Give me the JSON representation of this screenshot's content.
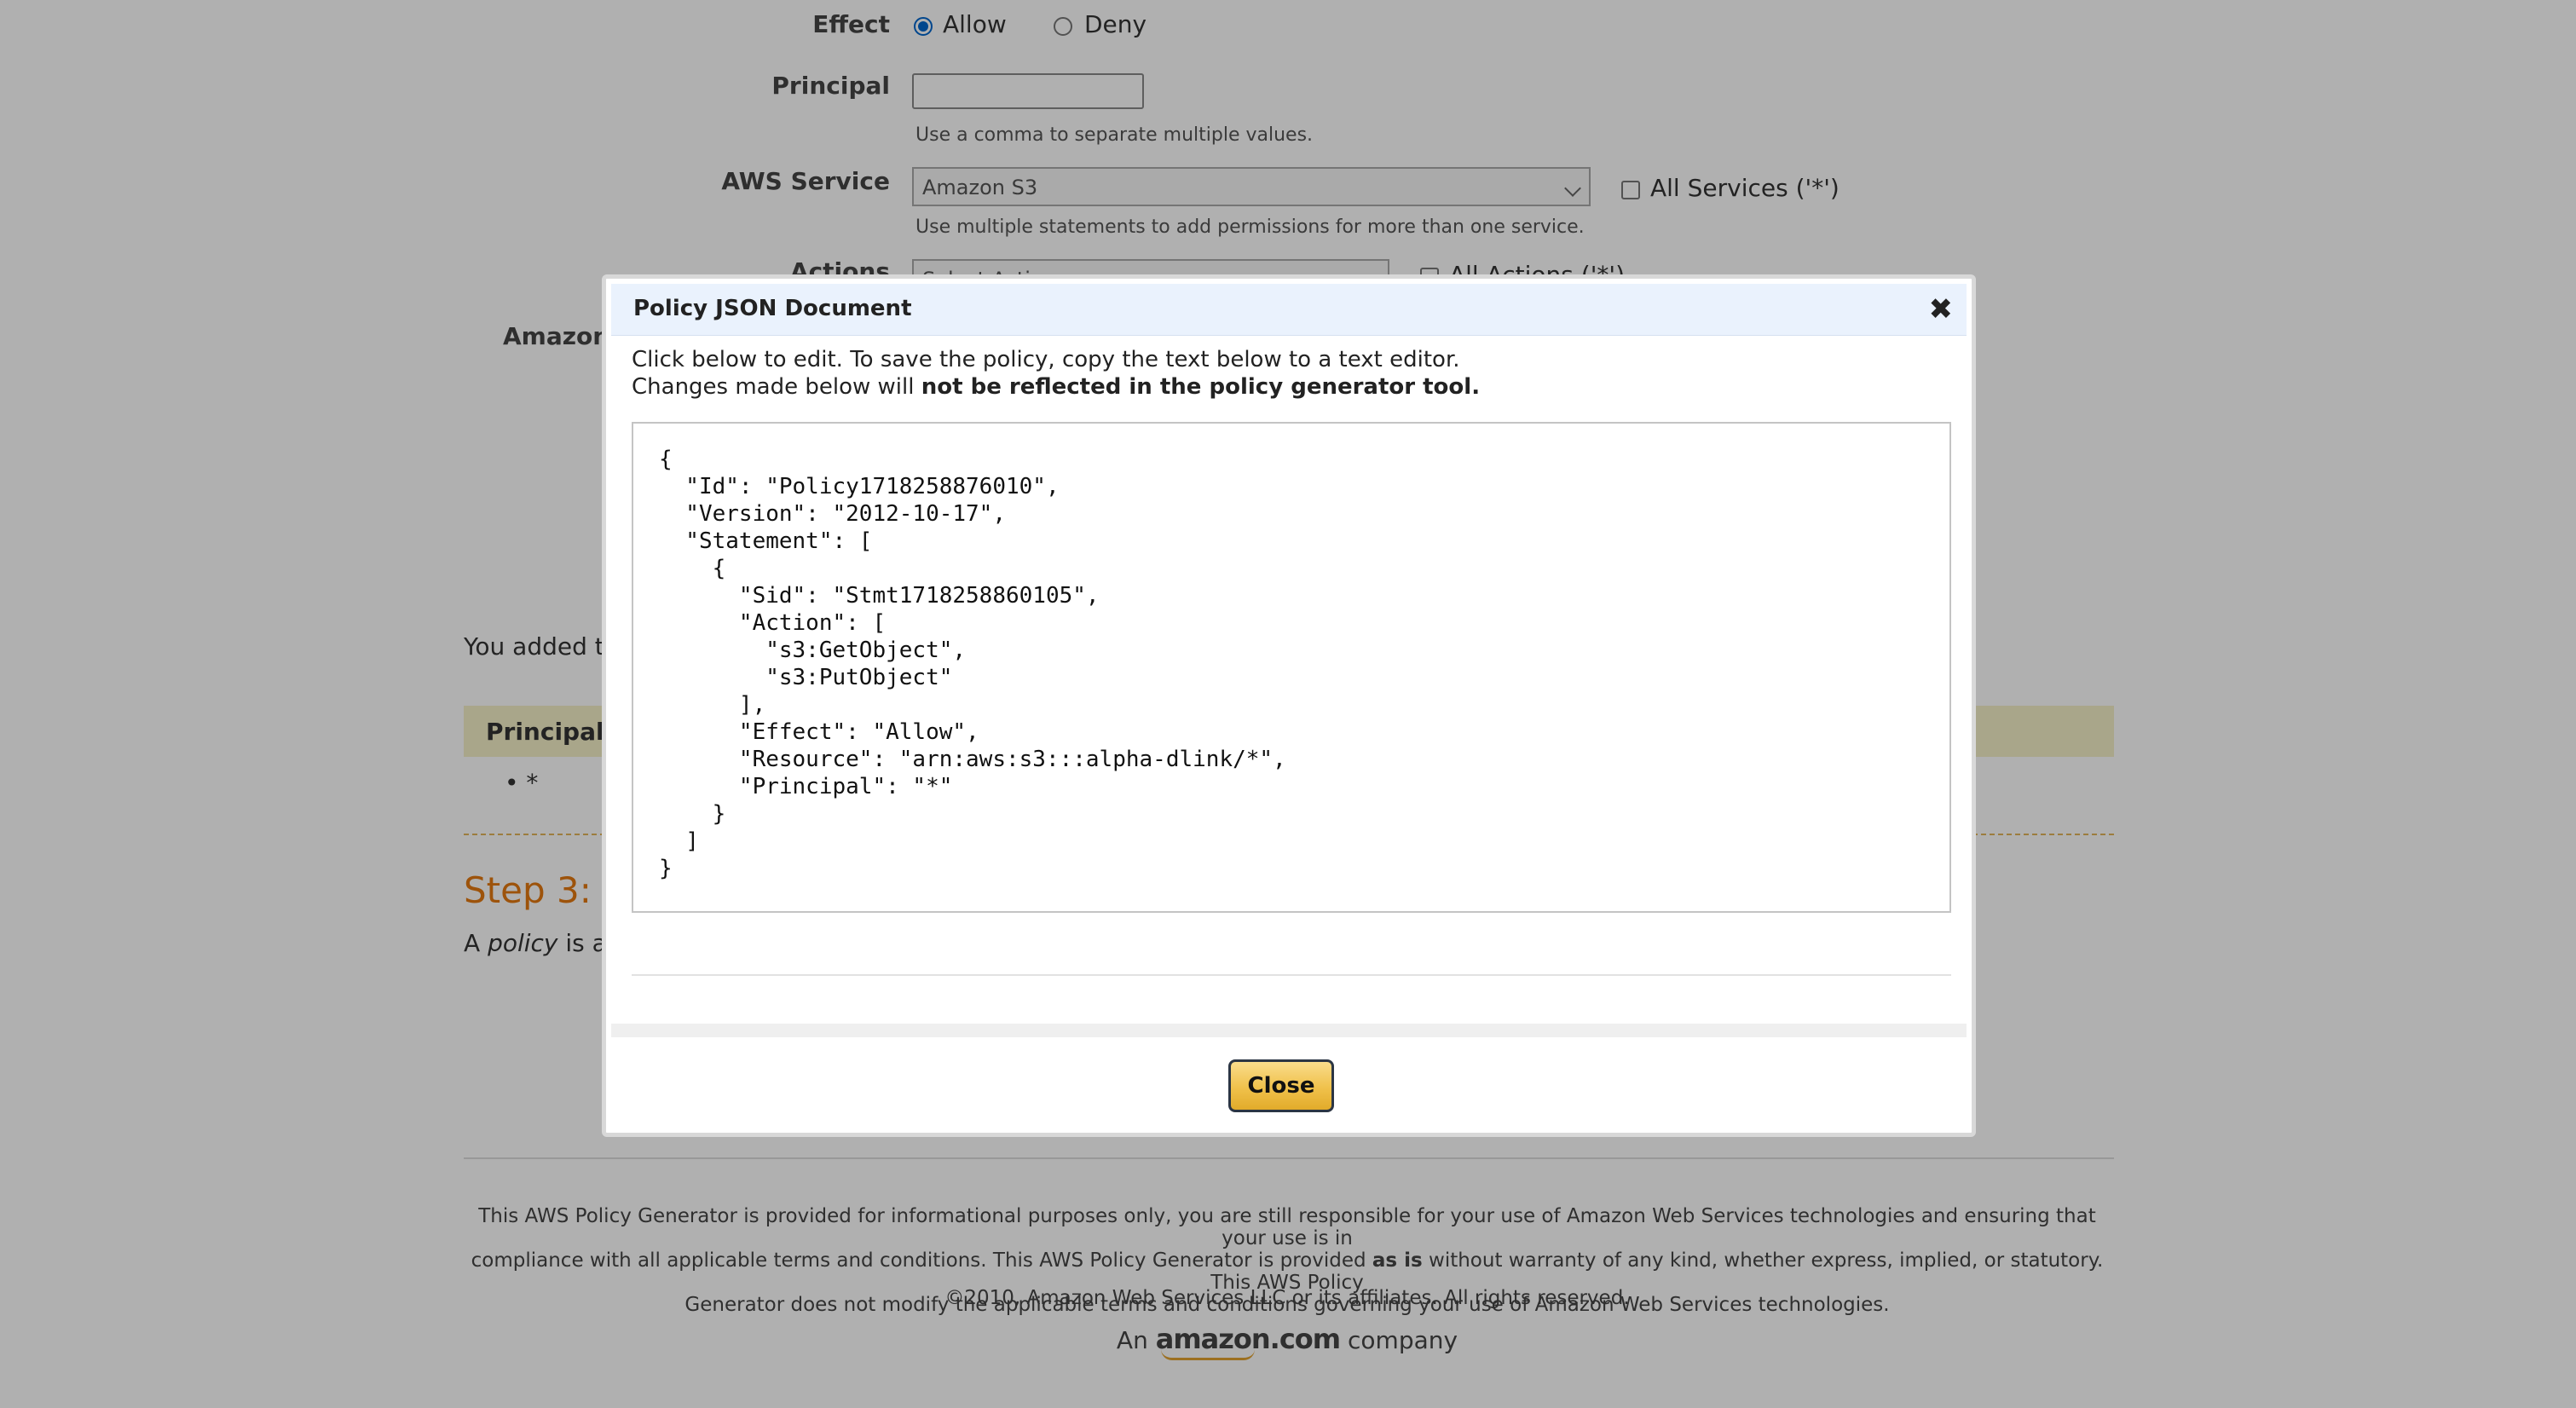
{
  "form": {
    "effect": {
      "label": "Effect",
      "options": [
        "Allow",
        "Deny"
      ],
      "selected": "Allow"
    },
    "principal": {
      "label": "Principal",
      "value": "",
      "hint": "Use a comma to separate multiple values."
    },
    "aws_service": {
      "label": "AWS Service",
      "selected": "Amazon S3",
      "all_services_label": "All Services ('*')",
      "hint": "Use multiple statements to add permissions for more than one service."
    },
    "actions": {
      "label": "Actions",
      "selected": "Select Actions",
      "all_actions_label": "All Actions ('*')"
    },
    "arn_label_partial": "Amazon"
  },
  "summary": {
    "added_text_partial": "You added th",
    "table_header_partial": "Principal(",
    "principal_bullet": "*"
  },
  "step3": {
    "heading_partial": "Step 3:",
    "desc_a": "A ",
    "desc_policy": "policy",
    "desc_b": " is a"
  },
  "modal": {
    "title": "Policy JSON Document",
    "close_x": "✖",
    "intro_line1": "Click below to edit. To save the policy, copy the text below to a text editor.",
    "intro_line2_prefix": "Changes made below will ",
    "intro_line2_bold": "not be reflected in the policy generator tool.",
    "json_text": "{\n  \"Id\": \"Policy1718258876010\",\n  \"Version\": \"2012-10-17\",\n  \"Statement\": [\n    {\n      \"Sid\": \"Stmt1718258860105\",\n      \"Action\": [\n        \"s3:GetObject\",\n        \"s3:PutObject\"\n      ],\n      \"Effect\": \"Allow\",\n      \"Resource\": \"arn:aws:s3:::alpha-dlink/*\",\n      \"Principal\": \"*\"\n    }\n  ]\n}",
    "close_button": "Close"
  },
  "footer": {
    "disclaimer_1": "This AWS Policy Generator is provided for informational purposes only, you are still responsible for your use of Amazon Web Services technologies and ensuring that your use is in",
    "disclaimer_2a": "compliance with all applicable terms and conditions. This AWS Policy Generator is provided ",
    "disclaimer_2_bold": "as is",
    "disclaimer_2b": " without warranty of any kind, whether express, implied, or statutory. This AWS Policy",
    "disclaimer_3": "Generator does not modify the applicable terms and conditions governing your use of Amazon Web Services technologies.",
    "copyright": "©2010, Amazon Web Services LLC or its affiliates. All rights reserved.",
    "brand_prefix": "An",
    "brand_logo": "amazon.com",
    "brand_suffix": "company"
  },
  "colors": {
    "overlay": "rgba(0,0,0,0.31)",
    "modal_header_bg": "#eaf2fd",
    "close_button_bg": "#f0c14b",
    "step_heading": "#e47911",
    "table_header_bg": "#f5f1c8",
    "radio_selected": "#0066cc"
  }
}
